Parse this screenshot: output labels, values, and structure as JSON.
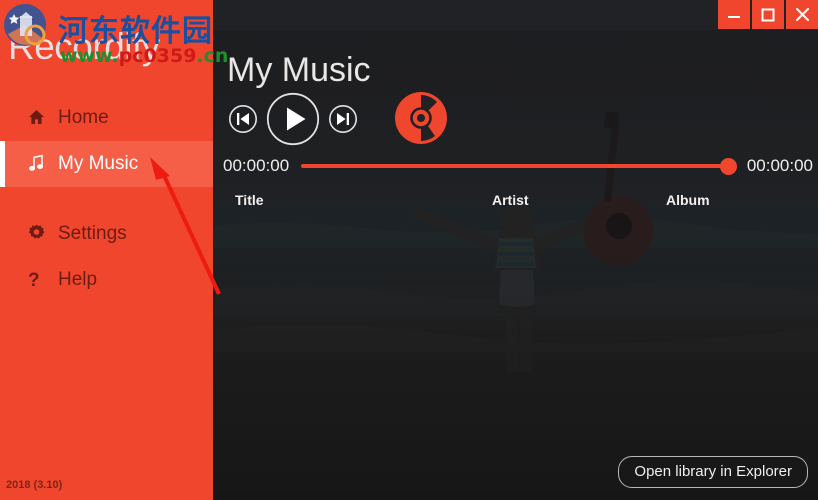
{
  "window": {
    "buttons": [
      {
        "name": "minimize",
        "glyph": "minimize-icon"
      },
      {
        "name": "maximize",
        "glyph": "maximize-icon"
      },
      {
        "name": "close",
        "glyph": "close-icon"
      }
    ]
  },
  "sidebar": {
    "brand": "Recordify",
    "version": "2018 (3.10)",
    "items": [
      {
        "label": "Home",
        "icon": "home-icon",
        "active": false
      },
      {
        "label": "My Music",
        "icon": "music-note-icon",
        "active": true
      },
      {
        "label": "Settings",
        "icon": "gear-icon",
        "active": false
      },
      {
        "label": "Help",
        "icon": "question-mark-icon",
        "active": false
      }
    ]
  },
  "watermark": {
    "chinese": "河东软件园",
    "url_green_1": "www.",
    "url_red": "pc0359",
    "url_green_2": ".cn"
  },
  "main": {
    "page_title": "My Music",
    "transport": {
      "previous": "previous-track-icon",
      "play": "play-icon",
      "next": "next-track-icon",
      "disc": "vinyl-record-icon"
    },
    "progress": {
      "elapsed": "00:00:00",
      "total": "00:00:00",
      "percent": 100
    },
    "columns": [
      "Title",
      "Artist",
      "Album"
    ],
    "open_library_label": "Open library in Explorer"
  },
  "colors": {
    "accent": "#f1462e",
    "accent_active": "#f55f47",
    "dark": "#212225",
    "sidebar_text": "#6e1c12",
    "annotation": "#ee1c10"
  }
}
